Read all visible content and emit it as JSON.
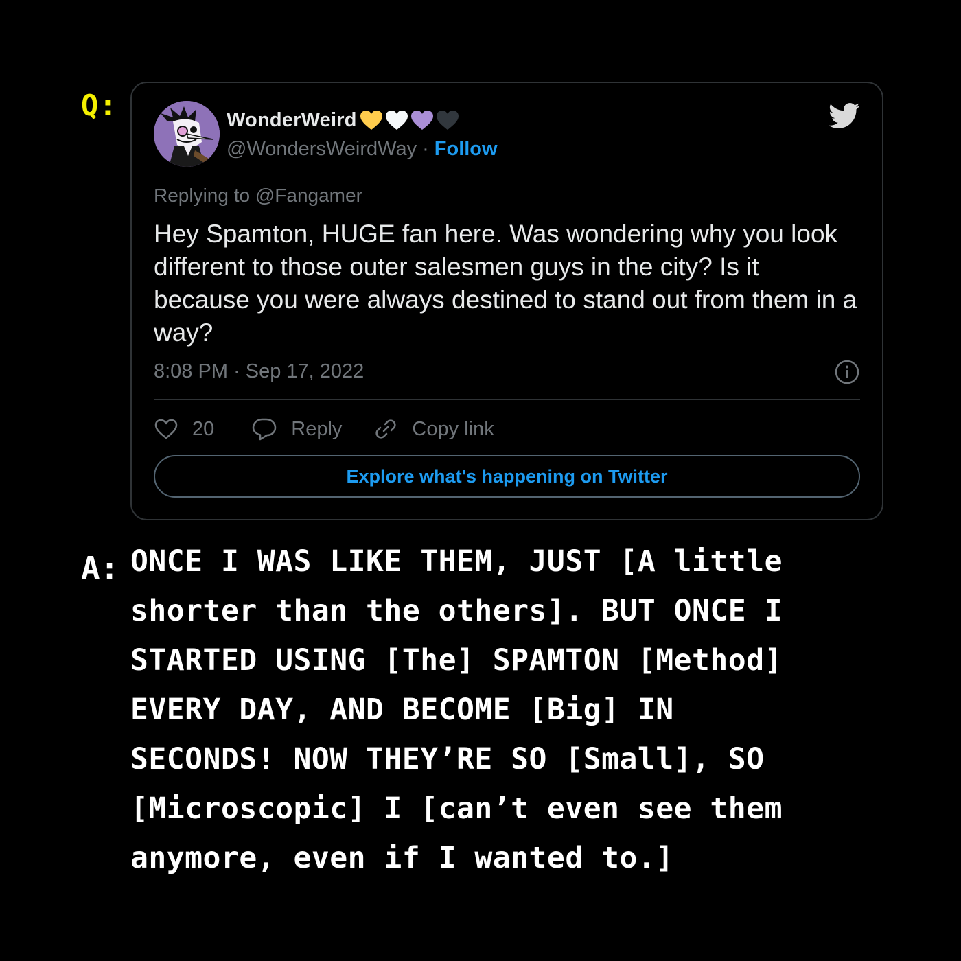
{
  "q_label": "Q:",
  "a_label": "A:",
  "tweet": {
    "display_name": "WonderWeird",
    "name_hearts": [
      {
        "icon": "yellow-heart-icon",
        "color": "#ffcc4d"
      },
      {
        "icon": "white-heart-icon",
        "color": "#f5f8fa"
      },
      {
        "icon": "purple-heart-icon",
        "color": "#aa8ed6"
      },
      {
        "icon": "black-heart-icon",
        "color": "#31373d"
      }
    ],
    "handle": "@WondersWeirdWay",
    "separator": "·",
    "follow_label": "Follow",
    "replying_to": "Replying to @Fangamer",
    "text": "Hey Spamton, HUGE fan here. Was wondering why you look different to those outer salesmen guys in the city? Is it because you were always destined to stand out from them in a way?",
    "timestamp": "8:08 PM · Sep 17, 2022",
    "like_count": "20",
    "reply_label": "Reply",
    "copy_link_label": "Copy link",
    "explore_label": "Explore what's happening on Twitter"
  },
  "answer": {
    "lines": [
      "ONCE I WAS LIKE THEM, JUST [A little",
      "shorter than the others]. BUT ONCE I",
      "STARTED USING [The] SPAMTON [Method]",
      "EVERY DAY, AND BECOME [Big] IN",
      "SECONDS! NOW THEY’RE SO [Small], SO",
      "[Microscopic] I [can’t even see them",
      "anymore, even if I wanted to.]"
    ]
  },
  "colors": {
    "background": "#000000",
    "q_label": "#f5f000",
    "link_blue": "#1d9bf0",
    "muted_text": "#71767b",
    "card_border": "#2f3336"
  }
}
